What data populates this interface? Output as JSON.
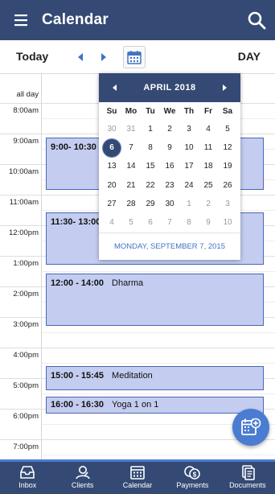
{
  "header": {
    "title": "Calendar",
    "menu_icon": "hamburger-menu-icon",
    "search_icon": "search-icon"
  },
  "toolbar": {
    "today_label": "Today",
    "view_label": "DAY"
  },
  "day_view": {
    "allday_label": "all day",
    "times": [
      "8:00am",
      "9:00am",
      "10:00am",
      "11:00am",
      "12:00pm",
      "1:00pm",
      "2:00pm",
      "3:00pm",
      "4:00pm",
      "5:00pm",
      "6:00pm",
      "7:00pm"
    ],
    "events": [
      {
        "time": "9:00- 10:30",
        "name": ""
      },
      {
        "time": "11:30- 13:00",
        "name": ""
      },
      {
        "time": "12:00 - 14:00",
        "name": "Dharma"
      },
      {
        "time": "15:00 - 15:45",
        "name": "Meditation"
      },
      {
        "time": "16:00 - 16:30",
        "name": "Yoga 1 on 1"
      }
    ]
  },
  "datepicker": {
    "month_label": "APRIL 2018",
    "weekdays": [
      "Su",
      "Mo",
      "Tu",
      "We",
      "Th",
      "Fr",
      "Sa"
    ],
    "weeks": [
      [
        "30",
        "31",
        "1",
        "2",
        "3",
        "4",
        "5"
      ],
      [
        "6",
        "7",
        "8",
        "9",
        "10",
        "11",
        "12"
      ],
      [
        "13",
        "14",
        "15",
        "16",
        "17",
        "18",
        "19"
      ],
      [
        "20",
        "21",
        "22",
        "23",
        "24",
        "25",
        "26"
      ],
      [
        "27",
        "28",
        "29",
        "30",
        "1",
        "2",
        "3"
      ],
      [
        "4",
        "5",
        "6",
        "7",
        "8",
        "9",
        "10"
      ]
    ],
    "selected_day": "6",
    "footer_date": "MONDAY, SEPTEMBER 7, 2015"
  },
  "bottom_nav": [
    {
      "label": "Inbox",
      "icon": "inbox-icon"
    },
    {
      "label": "Clients",
      "icon": "clients-icon"
    },
    {
      "label": "Calendar",
      "icon": "calendar-icon"
    },
    {
      "label": "Payments",
      "icon": "payments-icon"
    },
    {
      "label": "Documents",
      "icon": "documents-icon"
    }
  ],
  "colors": {
    "primary": "#344a74",
    "accent": "#4a7cd2",
    "event_fill": "#c4cdf0",
    "event_border": "#4a66b8"
  }
}
